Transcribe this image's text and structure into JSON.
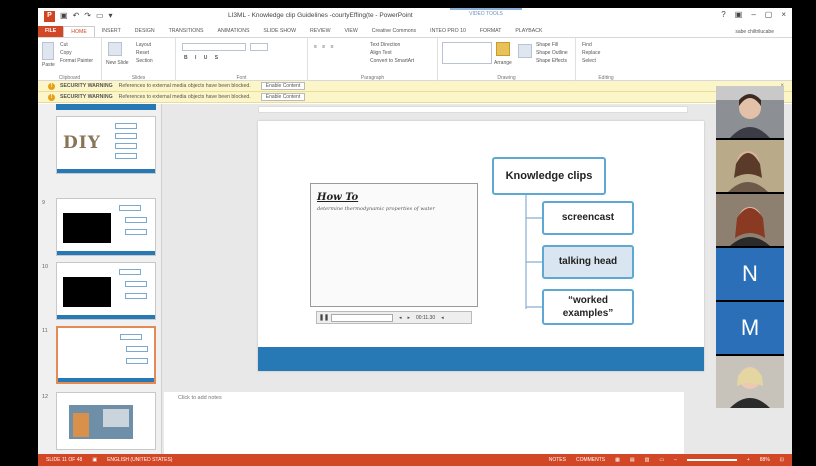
{
  "window": {
    "title": "LI3ML - Knowledge clip Guidelines -courtyEffing(te - PowerPoint",
    "context_tab_group": "VIDEO TOOLS",
    "controls": [
      "?",
      "▣",
      "–",
      "▢",
      "×"
    ]
  },
  "tabs": {
    "items": [
      "FILE",
      "HOME",
      "INSERT",
      "DESIGN",
      "TRANSITIONS",
      "ANIMATIONS",
      "SLIDE SHOW",
      "REVIEW",
      "VIEW",
      "Creative Commons",
      "INTEO PRO 10",
      "FORMAT",
      "PLAYBACK"
    ],
    "active": "HOME",
    "user": "sabe chiltrilucabe"
  },
  "ribbon": {
    "groups": [
      "Clipboard",
      "Slides",
      "Font",
      "Paragraph",
      "Drawing",
      "Editing"
    ],
    "clipboard": {
      "cut": "Cut",
      "copy": "Copy",
      "format_painter": "Format Painter",
      "paste": "Paste"
    },
    "slides": {
      "new_slide": "New Slide",
      "layout": "Layout",
      "reset": "Reset",
      "section": "Section"
    },
    "paragraph": {
      "text_direction": "Text Direction",
      "align_text": "Align Text",
      "convert": "Convert to SmartArt"
    },
    "drawing": {
      "arrange": "Arrange",
      "quick_styles": "Quick Styles",
      "shape_fill": "Shape Fill",
      "shape_outline": "Shape Outline",
      "shape_effects": "Shape Effects"
    },
    "editing": {
      "find": "Find",
      "replace": "Replace",
      "select": "Select"
    }
  },
  "security": {
    "label": "SECURITY WARNING",
    "message": "References to external media objects have been blocked.",
    "button": "Enable Content",
    "close": "×"
  },
  "thumbnails": [
    {
      "num": "",
      "kind": "diy"
    },
    {
      "num": "9",
      "kind": "video"
    },
    {
      "num": "10",
      "kind": "video"
    },
    {
      "num": "11",
      "kind": "current"
    },
    {
      "num": "12",
      "kind": "photo"
    }
  ],
  "thumb_text": {
    "diy": "DIY"
  },
  "slide": {
    "video": {
      "handwriting_title": "How To",
      "handwriting_line": "determine thermodynamic properties of water",
      "time": "00:11.30"
    },
    "nodes": {
      "root": "Knowledge clips",
      "a": "screencast",
      "b": "talking head",
      "c_line1": "“worked",
      "c_line2": "examples”"
    }
  },
  "notes": {
    "placeholder": "Click to add notes"
  },
  "cams": {
    "letter1": "N",
    "letter2": "M"
  },
  "status": {
    "slide_info": "SLIDE 11 OF 48",
    "language": "ENGLISH (UNITED STATES)",
    "notes": "NOTES",
    "comments": "COMMENTS",
    "zoom": "88%"
  },
  "colors": {
    "accent": "#d24726",
    "slide_band": "#2679b5",
    "node_border": "#5fa8d3",
    "cam_letter_bg": "#2a6fb7",
    "warning_bar": "#fcf5c7"
  }
}
